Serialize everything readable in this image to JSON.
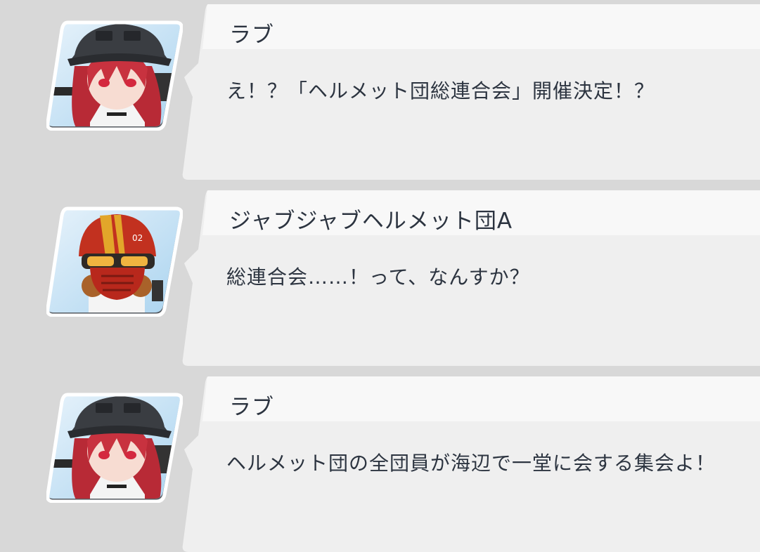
{
  "messages": [
    {
      "speaker": "ラブ",
      "text": "え！？「ヘルメット団総連合会」開催決定！？",
      "avatar_icon": "helmet-girl-black-helmet-portrait-icon"
    },
    {
      "speaker": "ジャブジャブヘルメット団A",
      "text": "総連合会……！って、なんすか？",
      "avatar_icon": "red-helmet-gasmask-portrait-icon",
      "helmet_number": "02"
    },
    {
      "speaker": "ラブ",
      "text": "ヘルメット団の全団員が海辺で一堂に会する集会よ！",
      "avatar_icon": "helmet-girl-black-helmet-portrait-icon"
    }
  ],
  "colors": {
    "background": "#d8d8d8",
    "bubble": "#efefef",
    "name_strip": "#f8f8f8",
    "text": "#2c3440",
    "hair": "#c8323f",
    "black_helmet": "#3a3d42",
    "red_helmet": "#c2311f"
  }
}
